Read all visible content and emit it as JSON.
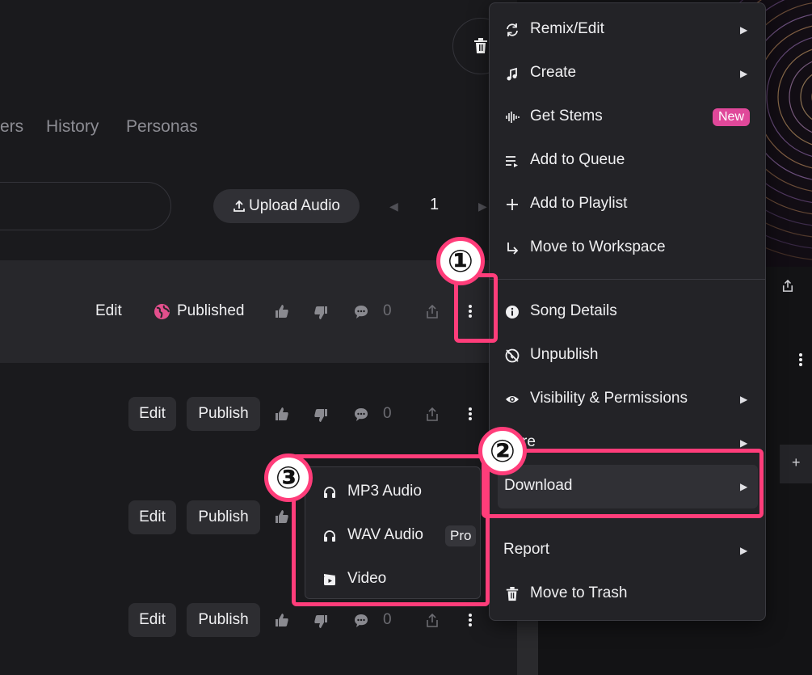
{
  "tabs": [
    "ers",
    "History",
    "Personas"
  ],
  "upload_button": "Upload Audio",
  "pager": {
    "current": "1"
  },
  "rows": [
    {
      "edit": "Edit",
      "status": "Published",
      "comments": "0"
    },
    {
      "edit": "Edit",
      "publish": "Publish",
      "comments": "0"
    },
    {
      "edit": "Edit",
      "publish": "Publish"
    },
    {
      "edit": "Edit",
      "publish": "Publish",
      "comments": "0"
    }
  ],
  "menu": {
    "items": [
      {
        "label": "Remix/Edit",
        "icon": "remix-icon",
        "submenu": true
      },
      {
        "label": "Create",
        "icon": "music-note-icon",
        "submenu": true
      },
      {
        "label": "Get Stems",
        "icon": "waveform-icon",
        "badge": "New"
      },
      {
        "label": "Add to Queue",
        "icon": "queue-icon"
      },
      {
        "label": "Add to Playlist",
        "icon": "plus-icon"
      },
      {
        "label": "Move to Workspace",
        "icon": "arrow-return-icon"
      },
      {
        "label": "Song Details",
        "icon": "info-icon"
      },
      {
        "label": "Unpublish",
        "icon": "unpublish-icon"
      },
      {
        "label": "Visibility & Permissions",
        "icon": "eye-icon",
        "submenu": true
      },
      {
        "label": "re",
        "submenu": true
      },
      {
        "label": "Download",
        "submenu": true
      },
      {
        "label": "Report",
        "submenu": true
      },
      {
        "label": "Move to Trash",
        "icon": "trash-icon"
      }
    ]
  },
  "download_submenu": [
    {
      "label": "MP3 Audio",
      "icon": "headphones-icon"
    },
    {
      "label": "WAV Audio",
      "icon": "headphones-icon",
      "badge": "Pro"
    },
    {
      "label": "Video",
      "icon": "video-icon"
    }
  ],
  "annotations": [
    "①",
    "②",
    "③"
  ],
  "colors": {
    "accent": "#ff3d7a",
    "new_badge": "#e0489a",
    "published_globe": "#e34f8c"
  }
}
